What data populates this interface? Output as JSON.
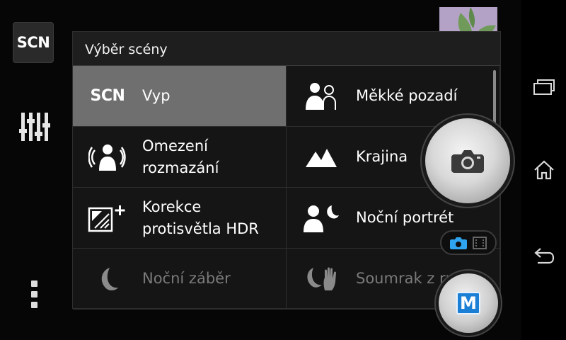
{
  "left_rail": {
    "scene_button_label": "SCN",
    "icons": {
      "settings": "sliders-icon",
      "more": "overflow-menu-icon"
    }
  },
  "scene_panel": {
    "title": "Výběr scény",
    "items": [
      {
        "label": "Vyp",
        "icon": "scn-text-icon",
        "icon_text": "SCN",
        "selected": true,
        "enabled": true
      },
      {
        "label": "Měkké pozadí",
        "icon": "soft-background-icon",
        "selected": false,
        "enabled": true
      },
      {
        "label": "Omezení rozmazání",
        "line1": "Omezení",
        "line2": "rozmazání",
        "icon": "anti-blur-icon",
        "selected": false,
        "enabled": true
      },
      {
        "label": "Krajina",
        "icon": "landscape-icon",
        "selected": false,
        "enabled": true
      },
      {
        "label": "Korekce protisvětla HDR",
        "line1": "Korekce",
        "line2": "protisvětla HDR",
        "icon": "backlight-hdr-icon",
        "selected": false,
        "enabled": true
      },
      {
        "label": "Noční portrét",
        "icon": "night-portrait-icon",
        "selected": false,
        "enabled": true
      },
      {
        "label": "Noční záběr",
        "icon": "night-scene-icon",
        "selected": false,
        "enabled": false
      },
      {
        "label": "Soumrak z ruky",
        "icon": "handheld-twilight-icon",
        "selected": false,
        "enabled": false
      }
    ]
  },
  "controls": {
    "shutter_icon": "camera-icon",
    "mode_toggle": {
      "active": "photo",
      "icons": [
        "camera-icon",
        "video-icon"
      ]
    },
    "manual_mode_label": "M",
    "thumbnail_icon": "last-photo-thumbnail"
  },
  "nav_bar": {
    "buttons": [
      "recent-apps-icon",
      "home-icon",
      "back-icon"
    ]
  },
  "colors": {
    "selected_cell": "#6f6f6f",
    "accent_blue": "#1c7fd6",
    "panel_bg": "#151515"
  }
}
